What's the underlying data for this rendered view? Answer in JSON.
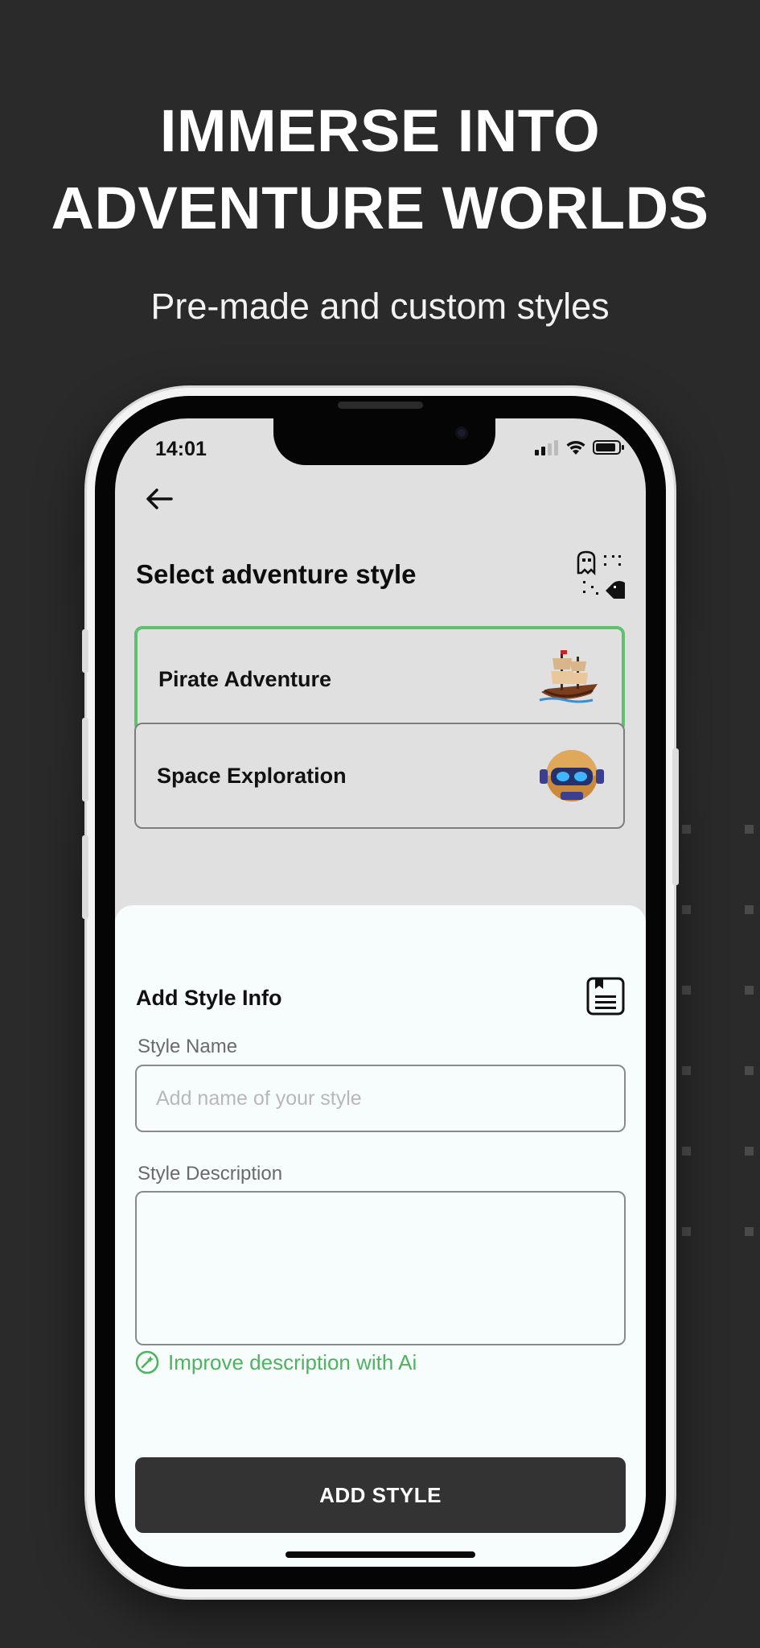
{
  "promo": {
    "headline_line1": "IMMERSE INTO",
    "headline_line2": "ADVENTURE WORLDS",
    "subheadline": "Pre-made and custom styles"
  },
  "status_bar": {
    "time": "14:01",
    "icons": [
      "cellular-signal-icon",
      "wifi-icon",
      "battery-icon"
    ]
  },
  "header": {
    "back_icon": "back-arrow-icon",
    "title": "Select adventure style",
    "style_icon": "pixel-ghost-pacman-icon"
  },
  "styles": [
    {
      "label": "Pirate Adventure",
      "selected": true,
      "icon": "pirate-ship-icon"
    },
    {
      "label": "Space Exploration",
      "selected": false,
      "icon": "robot-helmet-icon"
    }
  ],
  "add_style": {
    "title": "Add Style Info",
    "doc_icon": "document-icon",
    "name_label": "Style Name",
    "name_placeholder": "Add name of your style",
    "name_value": "",
    "description_label": "Style Description",
    "description_value": "",
    "ai_link": "Improve description with Ai",
    "submit_label": "ADD STYLE"
  },
  "colors": {
    "background": "#2a2a2b",
    "accent_green": "#5fc06e",
    "button_dark": "#333334",
    "sheet_bg": "#f7fcfd"
  }
}
